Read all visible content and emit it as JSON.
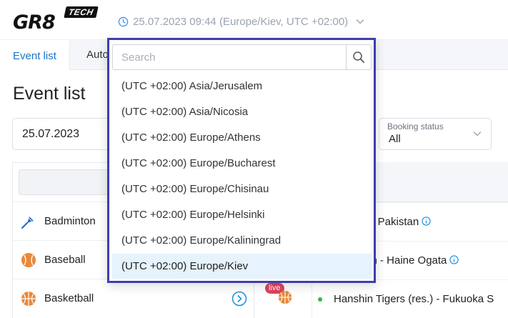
{
  "header": {
    "logo_text": "GR8",
    "logo_badge": "TECH",
    "timezone_display": "25.07.2023 09:44 (Europe/Kiev, UTC +02:00)"
  },
  "tabs": [
    {
      "label": "Event list",
      "active": true
    },
    {
      "label": "Auto"
    }
  ],
  "page": {
    "title": "Event list"
  },
  "filters": {
    "date_value": "25.07.2023",
    "booking_status_label": "Booking status",
    "booking_status_value": "All"
  },
  "sports": [
    {
      "name": "Badminton",
      "icon": "badminton-icon"
    },
    {
      "name": "Baseball",
      "icon": "baseball-icon"
    },
    {
      "name": "Basketball",
      "icon": "basketball-icon"
    }
  ],
  "events": [
    {
      "name": "a - Pakistan"
    },
    {
      "name": "am - Haine Ogata"
    },
    {
      "name": "Hanshin Tigers (res.) - Fukuoka S"
    }
  ],
  "live_badge": "live",
  "timezone_dropdown": {
    "search_placeholder": "Search",
    "options": [
      "(UTC +02:00) Asia/Jerusalem",
      "(UTC +02:00) Asia/Nicosia",
      "(UTC +02:00) Europe/Athens",
      "(UTC +02:00) Europe/Bucharest",
      "(UTC +02:00) Europe/Chisinau",
      "(UTC +02:00) Europe/Helsinki",
      "(UTC +02:00) Europe/Kaliningrad",
      "(UTC +02:00) Europe/Kiev"
    ],
    "selected": "(UTC +02:00) Europe/Kiev"
  },
  "colors": {
    "accent": "#1a73c9",
    "dropdown_border": "#3c3fae",
    "selected_bg": "#e6f2fc",
    "live": "#e0435c",
    "sport_orange": "#e8893a"
  }
}
